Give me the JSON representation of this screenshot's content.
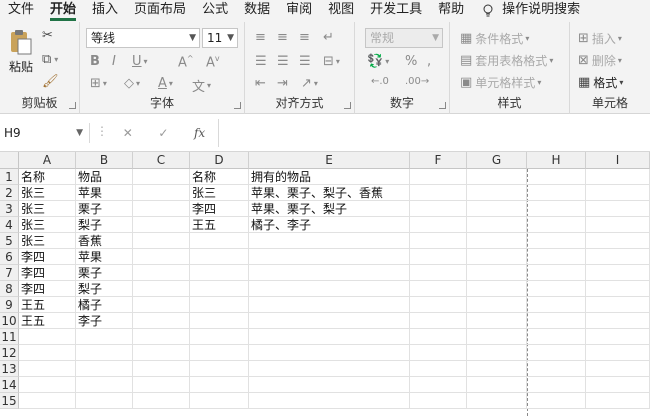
{
  "menu": {
    "items": [
      "文件",
      "开始",
      "插入",
      "页面布局",
      "公式",
      "数据",
      "审阅",
      "视图",
      "开发工具",
      "帮助"
    ],
    "active_index": 1,
    "tell_me": "操作说明搜索"
  },
  "ribbon": {
    "clipboard": {
      "label": "剪贴板",
      "paste": "粘贴"
    },
    "font": {
      "label": "字体",
      "name": "等线",
      "size": "11"
    },
    "alignment": {
      "label": "对齐方式"
    },
    "number": {
      "label": "数字",
      "format": "常规",
      "percent": "%"
    },
    "styles": {
      "label": "样式",
      "conditional": "条件格式",
      "table": "套用表格格式",
      "cell": "单元格样式"
    },
    "cells": {
      "label": "单元格",
      "insert": "插入",
      "delete": "删除",
      "format": "格式"
    }
  },
  "formula_bar": {
    "name_box": "H9",
    "fx": "fx",
    "content": ""
  },
  "sheet": {
    "columns": [
      "A",
      "B",
      "C",
      "D",
      "E",
      "F",
      "G",
      "H",
      "I"
    ],
    "rows": [
      "1",
      "2",
      "3",
      "4",
      "5",
      "6",
      "7",
      "8",
      "9",
      "10",
      "11",
      "12",
      "13",
      "14",
      "15"
    ],
    "cells": [
      [
        "名称",
        "物品",
        "",
        "名称",
        "拥有的物品",
        "",
        "",
        "",
        ""
      ],
      [
        "张三",
        "苹果",
        "",
        "张三",
        "苹果、栗子、梨子、香蕉",
        "",
        "",
        "",
        ""
      ],
      [
        "张三",
        "栗子",
        "",
        "李四",
        "苹果、栗子、梨子",
        "",
        "",
        "",
        ""
      ],
      [
        "张三",
        "梨子",
        "",
        "王五",
        "橘子、李子",
        "",
        "",
        "",
        ""
      ],
      [
        "张三",
        "香蕉",
        "",
        "",
        "",
        "",
        "",
        "",
        ""
      ],
      [
        "李四",
        "苹果",
        "",
        "",
        "",
        "",
        "",
        "",
        ""
      ],
      [
        "李四",
        "栗子",
        "",
        "",
        "",
        "",
        "",
        "",
        ""
      ],
      [
        "李四",
        "梨子",
        "",
        "",
        "",
        "",
        "",
        "",
        ""
      ],
      [
        "王五",
        "橘子",
        "",
        "",
        "",
        "",
        "",
        "",
        ""
      ],
      [
        "王五",
        "李子",
        "",
        "",
        "",
        "",
        "",
        "",
        ""
      ],
      [
        "",
        "",
        "",
        "",
        "",
        "",
        "",
        "",
        ""
      ],
      [
        "",
        "",
        "",
        "",
        "",
        "",
        "",
        "",
        ""
      ],
      [
        "",
        "",
        "",
        "",
        "",
        "",
        "",
        "",
        ""
      ],
      [
        "",
        "",
        "",
        "",
        "",
        "",
        "",
        "",
        ""
      ],
      [
        "",
        "",
        "",
        "",
        "",
        "",
        "",
        "",
        ""
      ]
    ]
  },
  "colors": {
    "accent": "#217346",
    "ribbon_bg": "#f3f3f3",
    "grid_line": "#e1e1e1"
  }
}
